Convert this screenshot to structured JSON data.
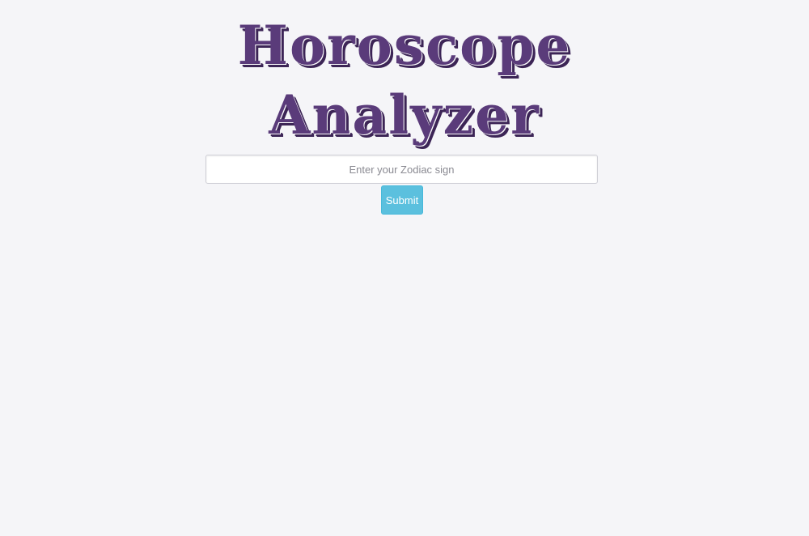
{
  "header": {
    "title_line_1": "Horoscope",
    "title_line_2": "Analyzer"
  },
  "form": {
    "sign_placeholder": "Enter your Zodiac sign",
    "sign_value": "",
    "submit_label": "Submit"
  },
  "colors": {
    "title": "#5a3b7a",
    "background": "#f5f5f8",
    "submit_button": "#5bc0de"
  }
}
